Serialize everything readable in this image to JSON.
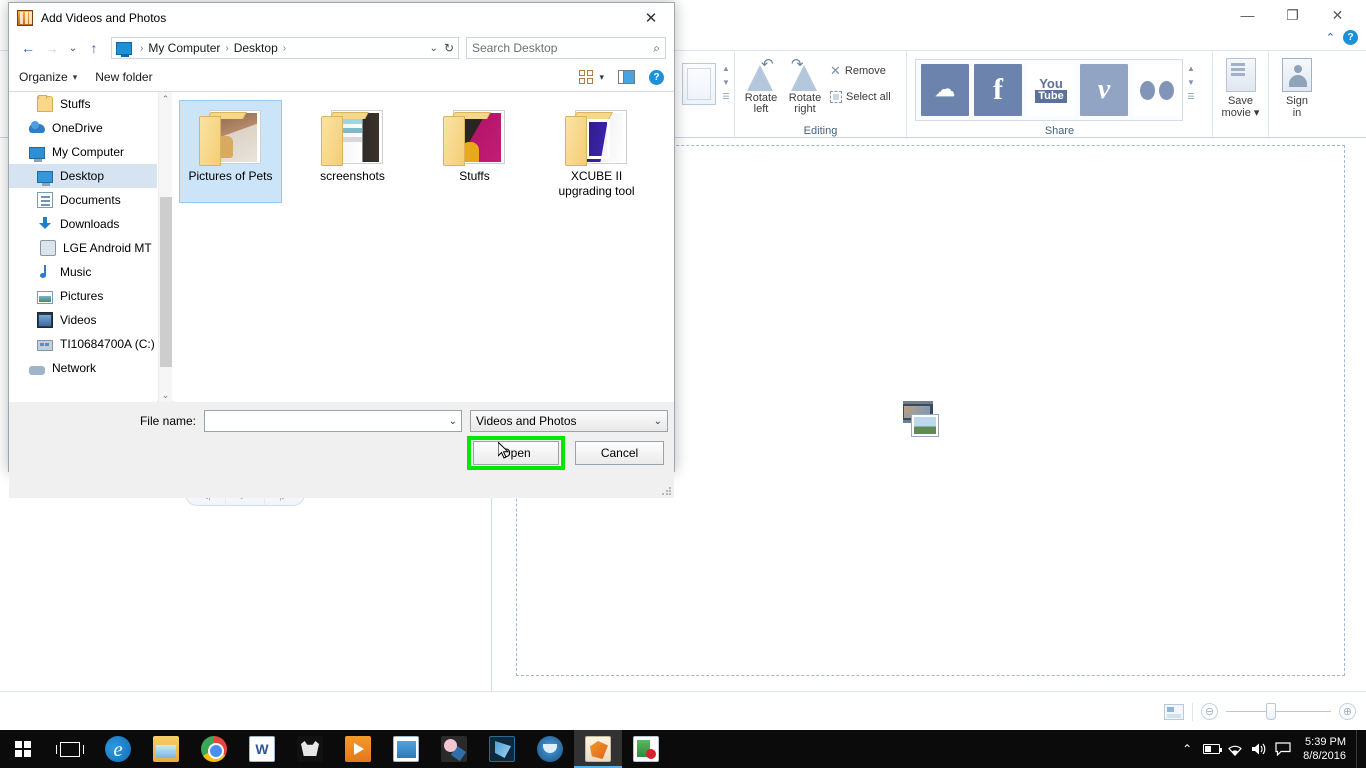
{
  "movie_maker": {
    "window_controls": {
      "minimize": "—",
      "maximize": "❐",
      "close": "✕"
    },
    "help": {
      "collapse_ribbon": "⌃",
      "help_label": "?"
    },
    "ribbon": {
      "groups": [
        {
          "name": "thumbnail",
          "label": ""
        },
        {
          "name": "editing",
          "label": "Editing"
        },
        {
          "name": "share",
          "label": "Share"
        }
      ],
      "editing": {
        "rotate_left": {
          "line1": "Rotate",
          "line2": "left"
        },
        "rotate_right": {
          "line1": "Rotate",
          "line2": "right"
        },
        "remove": "Remove",
        "select_all": "Select all"
      },
      "share": {
        "tiles": [
          "OneDrive",
          "Facebook",
          "YouTube",
          "Vimeo",
          "Flickr"
        ],
        "youtube_top": "You",
        "youtube_bottom": "Tube",
        "facebook_letter": "f",
        "vimeo_letter": "v"
      },
      "save_movie": {
        "line1": "Save",
        "line2": "movie ▾"
      },
      "sign_in": {
        "line1": "Sign",
        "line2": "in"
      }
    },
    "playback": {
      "previous": "◀|",
      "play": "▶",
      "next": "|▶"
    },
    "status_bar": {
      "view_icon": "storyboard-view-icon",
      "zoom_out": "⊖",
      "zoom_in": "⊕"
    }
  },
  "dialog": {
    "title": "Add Videos and Photos",
    "close_label": "✕",
    "nav": {
      "back": "←",
      "forward": "→",
      "recent": "⌄",
      "up": "↑",
      "breadcrumb": [
        "My Computer",
        "Desktop"
      ],
      "breadcrumb_separator": "›",
      "address_dropdown": "⌄",
      "refresh": "↻"
    },
    "search": {
      "placeholder": "Search Desktop",
      "value": "",
      "icon": "⌕"
    },
    "toolbar": {
      "organize": "Organize",
      "organize_caret": "▾",
      "new_folder": "New folder",
      "view_caret": "▾",
      "preview_pane": "preview-pane-icon",
      "help": "?"
    },
    "nav_pane": {
      "items": [
        {
          "label": "Stuffs",
          "icon": "folder-icon",
          "indent": 2,
          "selected": false
        },
        {
          "label": "OneDrive",
          "icon": "onedrive-icon",
          "indent": 1,
          "selected": false
        },
        {
          "label": "My Computer",
          "icon": "computer-icon",
          "indent": 1,
          "selected": false
        },
        {
          "label": "Desktop",
          "icon": "desktop-icon",
          "indent": 2,
          "selected": true
        },
        {
          "label": "Documents",
          "icon": "documents-icon",
          "indent": 2,
          "selected": false
        },
        {
          "label": "Downloads",
          "icon": "downloads-icon",
          "indent": 2,
          "selected": false
        },
        {
          "label": "LGE Android MT",
          "icon": "phone-icon",
          "indent": 2,
          "selected": false
        },
        {
          "label": "Music",
          "icon": "music-icon",
          "indent": 2,
          "selected": false
        },
        {
          "label": "Pictures",
          "icon": "pictures-icon",
          "indent": 2,
          "selected": false
        },
        {
          "label": "Videos",
          "icon": "videos-icon",
          "indent": 2,
          "selected": false
        },
        {
          "label": "TI10684700A (C:)",
          "icon": "drive-icon",
          "indent": 2,
          "selected": false
        },
        {
          "label": "Network",
          "icon": "network-icon",
          "indent": 1,
          "selected": false
        }
      ],
      "scroll_up": "⌃",
      "scroll_down": "⌄"
    },
    "files": [
      {
        "label": "Pictures of Pets",
        "type": "folder",
        "thumb": "c-pets",
        "selected": true
      },
      {
        "label": "screenshots",
        "type": "folder",
        "thumb": "c-screens",
        "selected": false
      },
      {
        "label": "Stuffs",
        "type": "folder",
        "thumb": "c-stuffs",
        "selected": false
      },
      {
        "label": "XCUBE II upgrading tool",
        "type": "folder",
        "thumb": "c-xcube",
        "selected": false
      }
    ],
    "file_name": {
      "label": "File name:",
      "value": "",
      "dropdown_caret": "⌄"
    },
    "file_type": {
      "value": "Videos and Photos",
      "dropdown_caret": "⌄"
    },
    "buttons": {
      "open": "Open",
      "cancel": "Cancel"
    },
    "highlight_color": "#00e800"
  },
  "taskbar": {
    "start": "windows-logo",
    "task_view": "task-view-icon",
    "apps": [
      {
        "name": "edge",
        "glyph": "e"
      },
      {
        "name": "file-explorer",
        "glyph": ""
      },
      {
        "name": "chrome",
        "glyph": ""
      },
      {
        "name": "word",
        "glyph": "W"
      },
      {
        "name": "wolf-app",
        "glyph": ""
      },
      {
        "name": "vlc",
        "glyph": ""
      },
      {
        "name": "powerpoint",
        "glyph": ""
      },
      {
        "name": "paint",
        "glyph": ""
      },
      {
        "name": "photoshop",
        "glyph": ""
      },
      {
        "name": "utorrent",
        "glyph": ""
      },
      {
        "name": "movie-maker",
        "glyph": "",
        "active": true
      },
      {
        "name": "media-player",
        "glyph": "",
        "active": false
      }
    ],
    "tray": {
      "show_hidden": "⌃",
      "battery": "battery-icon",
      "network": "ᴴ",
      "volume": "🔊",
      "action_center": "⌨",
      "time": "5:39 PM",
      "date": "8/8/2016"
    }
  }
}
